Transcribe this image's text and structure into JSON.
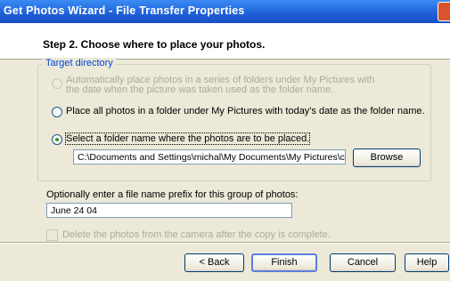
{
  "window": {
    "title": "Get Photos Wizard - File Transfer Properties"
  },
  "header": {
    "step_title": "Step 2. Choose where to place your photos."
  },
  "target_group": {
    "legend": "Target directory",
    "options": [
      {
        "label_line1": "Automatically place photos in a series of folders under My Pictures with",
        "label_line2": "the date when the picture was taken used as the folder name.",
        "enabled": false,
        "selected": false
      },
      {
        "label": "Place all photos in a folder under My Pictures with today's date as the folder name.",
        "enabled": true,
        "selected": false
      },
      {
        "label": "Select a folder name where the photos are to be placed.",
        "enabled": true,
        "selected": true
      }
    ],
    "folder_path": "C:\\Documents and Settings\\michal\\My Documents\\My Pictures\\cam",
    "browse_label": "Browse"
  },
  "prefix": {
    "label": "Optionally enter a file name prefix for this group of photos:",
    "value": "June 24 04"
  },
  "delete_option": {
    "label": "Delete the photos from the camera after the copy is complete.",
    "checked": false,
    "enabled": false
  },
  "buttons": {
    "back": "< Back",
    "finish": "Finish",
    "cancel": "Cancel",
    "help": "Help"
  },
  "colors": {
    "titlebar": "#1f5fd6",
    "dialog_bg": "#ece9d8",
    "legend_text": "#0046d5",
    "disabled_text": "#acaa99"
  }
}
